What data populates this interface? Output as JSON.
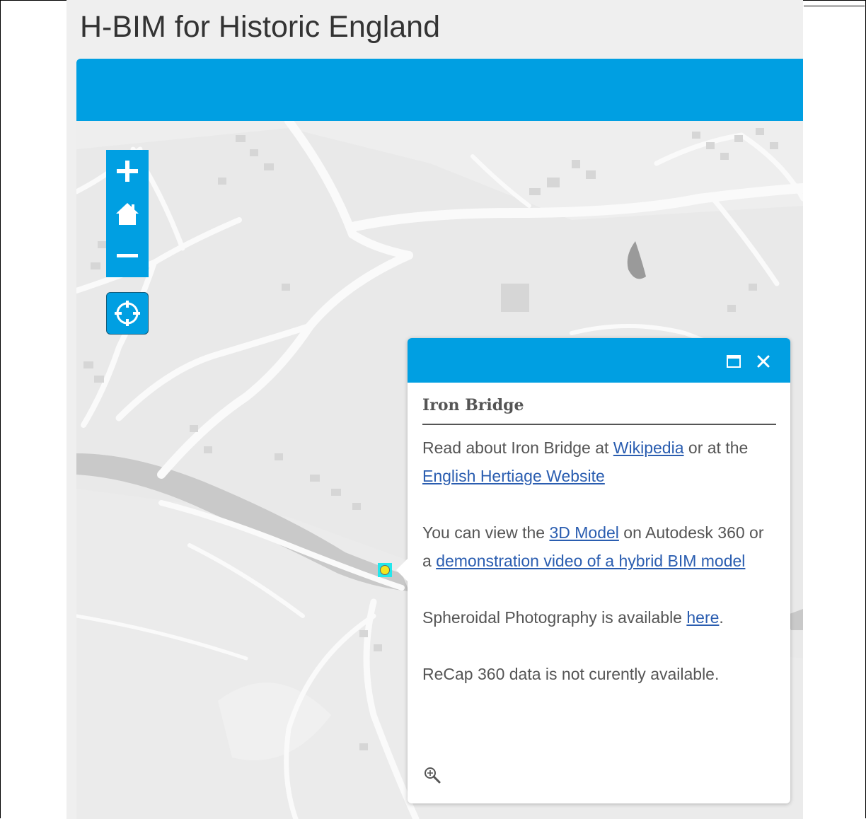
{
  "app": {
    "title": "H-BIM for Historic England"
  },
  "theme": {
    "accent": "#009fe2",
    "map_background": "#e9e9e9",
    "marker_fill": "#f4e71e",
    "marker_highlight": "#23e7ec"
  },
  "map_controls": {
    "zoom_in_icon": "plus-icon",
    "home_icon": "home-icon",
    "zoom_out_icon": "minus-icon",
    "locate_icon": "crosshair-icon"
  },
  "popup": {
    "title": "Iron Bridge",
    "maximize_icon": "maximize-icon",
    "close_icon": "close-icon",
    "para1": {
      "t1": "Read about Iron Bridge at ",
      "link1": "Wikipedia",
      "t2": " or at the ",
      "link2": "English Hertiage Website"
    },
    "para2": {
      "t1": "You can view the ",
      "link1": "3D Model",
      "t2": " on Autodesk 360 or a ",
      "link2": "demonstration video of a hybrid BIM model"
    },
    "para3": {
      "t1": "Spheroidal Photography is available ",
      "link1": "here",
      "t2": "."
    },
    "para4": "ReCap 360 data is not curently available.",
    "zoom_to_icon": "zoom-in-icon"
  }
}
